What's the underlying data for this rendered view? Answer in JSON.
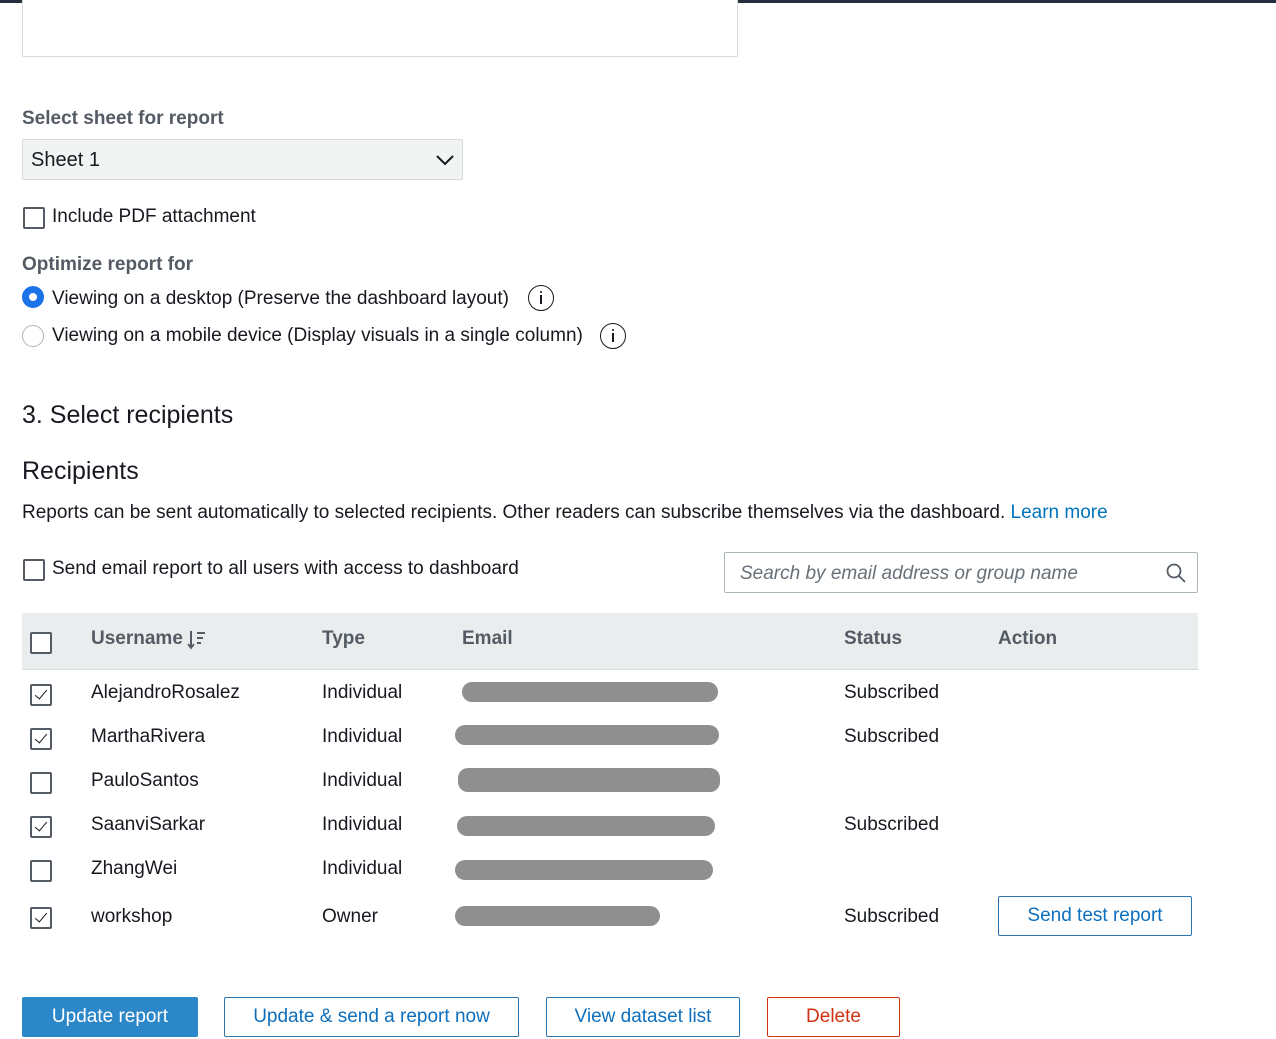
{
  "sheet_section": {
    "label": "Select sheet for report",
    "selected": "Sheet 1"
  },
  "pdf_attachment": {
    "label": "Include PDF attachment",
    "checked": false
  },
  "optimize": {
    "label": "Optimize report for",
    "options": [
      {
        "label": "Viewing on a desktop (Preserve the dashboard layout)",
        "selected": true
      },
      {
        "label": "Viewing on a mobile device (Display visuals in a single column)",
        "selected": false
      }
    ]
  },
  "recipients_section": {
    "step_title": "3. Select recipients",
    "title": "Recipients",
    "description": "Reports can be sent automatically to selected recipients. Other readers can subscribe themselves via the dashboard.",
    "learn_more": "Learn more",
    "send_all_label": "Send email report to all users with access to dashboard",
    "search_placeholder": "Search by email address or group name"
  },
  "table": {
    "columns": [
      "Username",
      "Type",
      "Email",
      "Status",
      "Action"
    ],
    "rows": [
      {
        "username": "AlejandroRosalez",
        "type": "Individual",
        "status": "Subscribed",
        "checked": true
      },
      {
        "username": "MarthaRivera",
        "type": "Individual",
        "status": "Subscribed",
        "checked": true
      },
      {
        "username": "PauloSantos",
        "type": "Individual",
        "status": "",
        "checked": false
      },
      {
        "username": "SaanviSarkar",
        "type": "Individual",
        "status": "Subscribed",
        "checked": true
      },
      {
        "username": "ZhangWei",
        "type": "Individual",
        "status": "",
        "checked": false
      },
      {
        "username": "workshop",
        "type": "Owner",
        "status": "Subscribed",
        "checked": true,
        "action": "Send test report"
      }
    ]
  },
  "buttons": {
    "update": "Update report",
    "update_send": "Update & send a report now",
    "view_dataset": "View dataset list",
    "delete": "Delete"
  }
}
